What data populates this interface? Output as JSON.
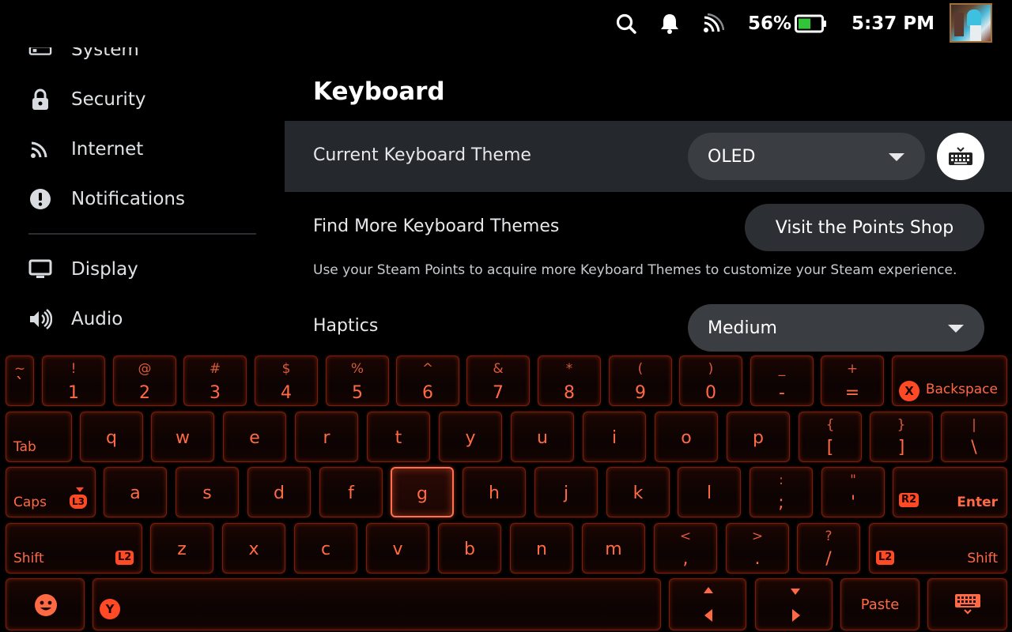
{
  "status_bar": {
    "battery_percent": "56%",
    "battery_level": 0.56,
    "time": "5:37 PM",
    "icons": [
      "search-icon",
      "bell-icon",
      "wifi-icon",
      "battery-icon",
      "avatar"
    ]
  },
  "sidebar": {
    "items": [
      {
        "label": "System",
        "icon": "system-icon"
      },
      {
        "label": "Security",
        "icon": "lock-icon"
      },
      {
        "label": "Internet",
        "icon": "wifi-icon"
      },
      {
        "label": "Notifications",
        "icon": "alert-icon"
      },
      {
        "label": "Display",
        "icon": "monitor-icon"
      },
      {
        "label": "Audio",
        "icon": "speaker-icon"
      }
    ]
  },
  "main": {
    "title": "Keyboard",
    "theme_row": {
      "label": "Current Keyboard Theme",
      "value": "OLED"
    },
    "shop_row": {
      "label": "Find More Keyboard Themes",
      "button": "Visit the Points Shop",
      "description": "Use your Steam Points to acquire more Keyboard Themes to customize your Steam experience."
    },
    "haptics_row": {
      "label": "Haptics",
      "value": "Medium"
    }
  },
  "keyboard": {
    "theme_colors": {
      "border": "#7a1e0c",
      "glyph": "#ff6a45",
      "badge": "#ff4a25"
    },
    "row1": [
      {
        "top": "~",
        "main": "`"
      },
      {
        "top": "!",
        "main": "1"
      },
      {
        "top": "@",
        "main": "2"
      },
      {
        "top": "#",
        "main": "3"
      },
      {
        "top": "$",
        "main": "4"
      },
      {
        "top": "%",
        "main": "5"
      },
      {
        "top": "^",
        "main": "6"
      },
      {
        "top": "&",
        "main": "7"
      },
      {
        "top": "*",
        "main": "8"
      },
      {
        "top": "(",
        "main": "9"
      },
      {
        "top": ")",
        "main": "0"
      },
      {
        "top": "_",
        "main": "-"
      },
      {
        "top": "+",
        "main": "="
      }
    ],
    "backspace": {
      "label": "Backspace",
      "badge": "X"
    },
    "tab": {
      "label": "Tab"
    },
    "row2": [
      "q",
      "w",
      "e",
      "r",
      "t",
      "y",
      "u",
      "i",
      "o",
      "p"
    ],
    "row2_brackets": [
      {
        "top": "{",
        "main": "["
      },
      {
        "top": "}",
        "main": "]"
      },
      {
        "top": "|",
        "main": "\\"
      }
    ],
    "caps": {
      "label": "Caps",
      "badge": "L3"
    },
    "row3": [
      "a",
      "s",
      "d",
      "f",
      "g",
      "h",
      "j",
      "k",
      "l"
    ],
    "row3_punct": [
      {
        "top": ":",
        "main": ";"
      },
      {
        "top": "\"",
        "main": "'"
      }
    ],
    "enter": {
      "label": "Enter",
      "badge": "R2"
    },
    "shift_left": {
      "label": "Shift",
      "badge": "L2"
    },
    "row4": [
      "z",
      "x",
      "c",
      "v",
      "b",
      "n",
      "m"
    ],
    "row4_punct": [
      {
        "top": "<",
        "main": ","
      },
      {
        "top": ">",
        "main": "."
      },
      {
        "top": "?",
        "main": "/"
      }
    ],
    "shift_right": {
      "label": "Shift",
      "badge": "L2"
    },
    "space": {
      "badge": "Y"
    },
    "paste": {
      "label": "Paste"
    },
    "focused_key": "g"
  }
}
